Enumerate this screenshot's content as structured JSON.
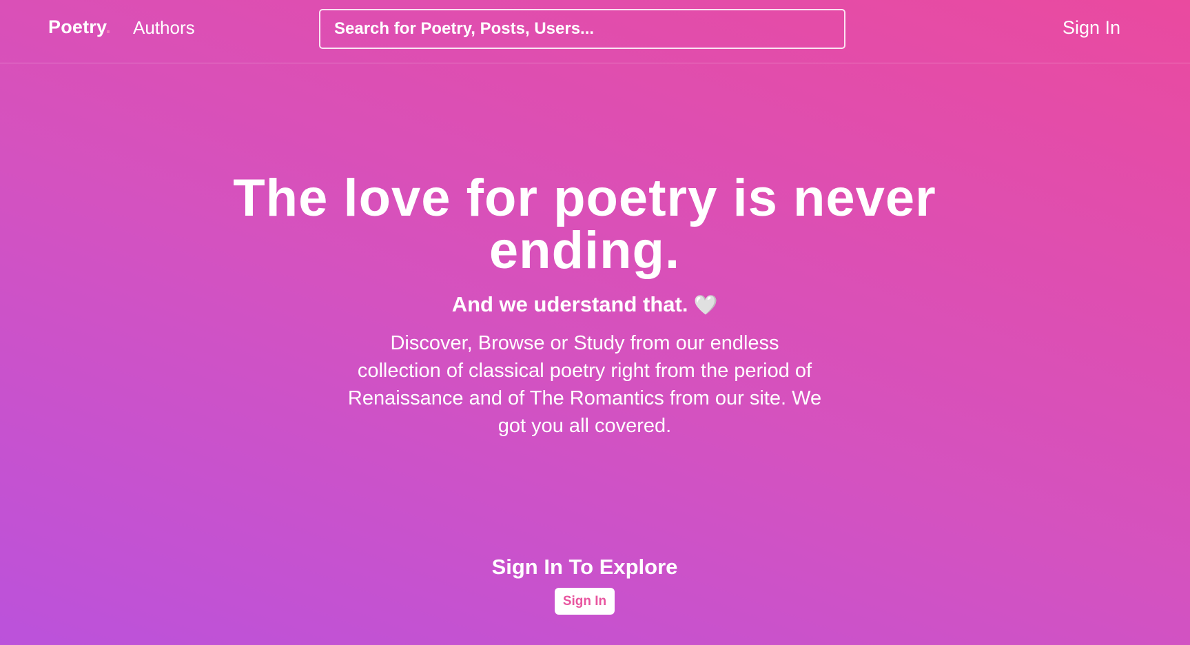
{
  "nav": {
    "brand": "Poetry",
    "brand_dot": ".",
    "authors_link": "Authors",
    "search_placeholder": "Search for Poetry, Posts, Users...",
    "signin_link": "Sign In"
  },
  "hero": {
    "title": "The love for poetry is never ending.",
    "subtitle": "And we uderstand that.",
    "heart_icon": "🤍",
    "description": "Discover, Browse or Study from our endless collection of classical poetry right from the period of Renaissance and of The Romantics from our site. We got you all covered."
  },
  "cta": {
    "heading": "Sign In To Explore",
    "button_label": "Sign In"
  },
  "colors": {
    "gradient_start": "#bb52db",
    "gradient_mid": "#d452c0",
    "gradient_end": "#ea4a9f",
    "button_text": "#e8559f"
  }
}
